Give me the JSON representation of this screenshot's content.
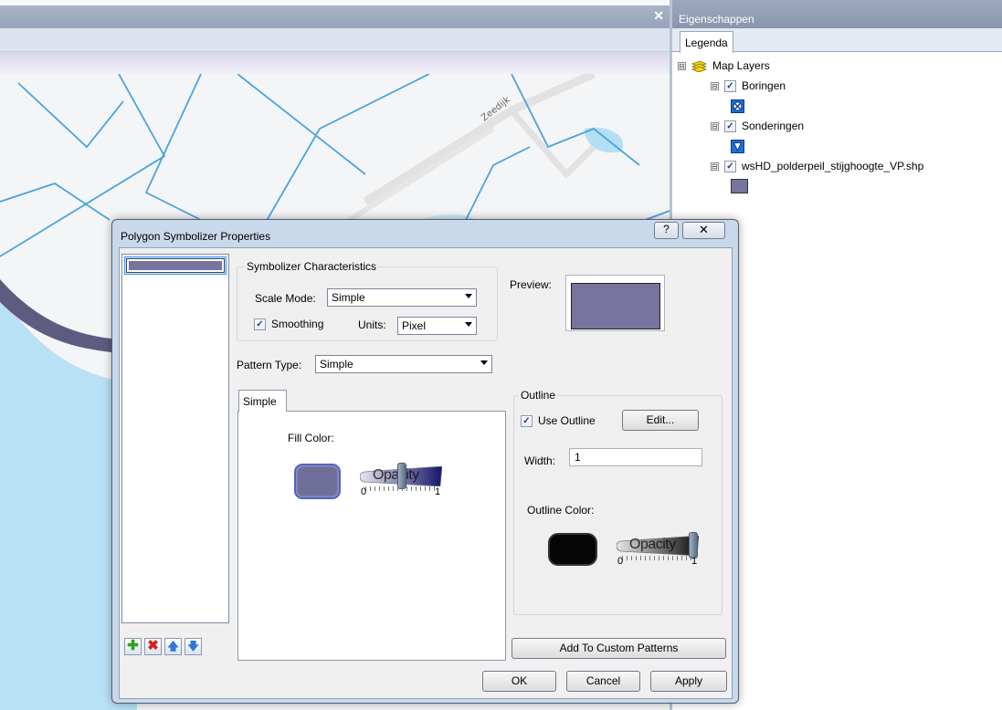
{
  "map": {
    "close_glyph": "✕",
    "street_label": "Zeedijk"
  },
  "properties_panel": {
    "title": "Eigenschappen",
    "tab_label": "Legenda",
    "tree": {
      "root_label": "Map Layers",
      "expander_glyph": "⊟",
      "check_glyph": "✓",
      "layers": [
        {
          "label": "Boringen",
          "checked": true,
          "symbol": "boring-symbol-icon"
        },
        {
          "label": "Sonderingen",
          "checked": true,
          "symbol": "sondering-symbol-icon"
        },
        {
          "label": "wsHD_polderpeil_stijghoogte_VP.shp",
          "checked": true,
          "symbol": "polygon-swatch",
          "color": "#77759d"
        }
      ]
    }
  },
  "dialog": {
    "title": "Polygon Symbolizer Properties",
    "help_glyph": "?",
    "close_glyph": "✕",
    "characteristics": {
      "group_label": "Symbolizer Characteristics",
      "scale_mode_label": "Scale Mode:",
      "scale_mode_value": "Simple",
      "smoothing_label": "Smoothing",
      "smoothing_checked": true,
      "units_label": "Units:",
      "units_value": "Pixel"
    },
    "preview_label": "Preview:",
    "pattern_type_label": "Pattern Type:",
    "pattern_type_value": "Simple",
    "pattern_tab_label": "Simple",
    "fill": {
      "label": "Fill Color:",
      "color": "#6f6e99",
      "opacity_label": "Opacity",
      "opacity_min": "0",
      "opacity_max": "1",
      "opacity_value": 0.5
    },
    "outline": {
      "group_label": "Outline",
      "use_outline_label": "Use Outline",
      "use_outline_checked": true,
      "edit_button": "Edit...",
      "width_label": "Width:",
      "width_value": "1",
      "color_label": "Outline Color:",
      "color": "#050505",
      "opacity_label": "Opacity",
      "opacity_min": "0",
      "opacity_max": "1",
      "opacity_value": 1.0
    },
    "list_tools": {
      "add": "✚",
      "remove": "✖",
      "up": "🡅",
      "down": "🡇"
    },
    "add_custom_button": "Add To Custom Patterns",
    "ok_button": "OK",
    "cancel_button": "Cancel",
    "apply_button": "Apply"
  },
  "colors": {
    "fill": "#77759d",
    "water": "#b3dff5",
    "boundary": "#4aa3e0"
  }
}
